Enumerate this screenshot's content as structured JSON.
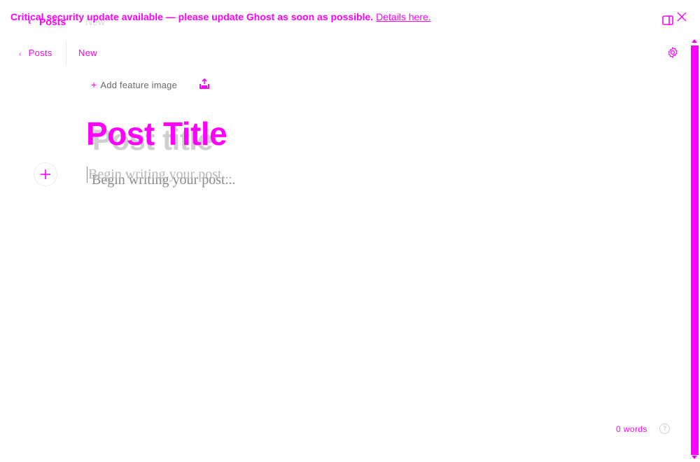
{
  "ghost_header": {
    "back_glyph": "‹",
    "posts": "Posts",
    "new": "New"
  },
  "banner": {
    "message": "Critical security update available — please update Ghost as soon as possible.",
    "link": "Details here."
  },
  "header": {
    "back_label": "Posts",
    "status": "New"
  },
  "editor": {
    "add_feature_image": "Add feature image",
    "title_placeholder": "Post Title",
    "title_ghost": "Post title",
    "body_placeholder": "Begin writing your post...",
    "body_ghost": "Begin writing your post..."
  },
  "footer": {
    "word_count": "0 words",
    "help": "?"
  },
  "icons": {
    "back": "chevron-left-icon",
    "close": "close-icon",
    "sidebar": "sidebar-toggle-icon",
    "settings": "gear-icon",
    "upload": "upload-icon",
    "add_card": "plus-icon"
  },
  "colors": {
    "accent": "#ff00ff",
    "placeholder": "#b8b8b8",
    "ghost_text": "#cfcfcf"
  }
}
